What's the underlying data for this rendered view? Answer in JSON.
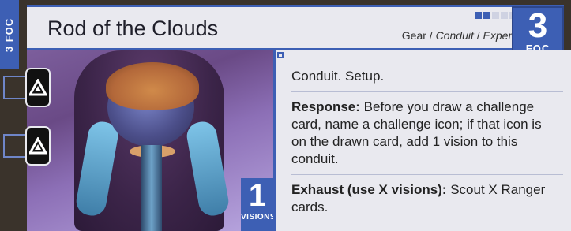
{
  "card": {
    "cost_label": "3 FOC",
    "title": "Rod of the Clouds",
    "type_gear": "Gear",
    "type_sep1": " / ",
    "type_conduit": "Conduit",
    "type_sep2": " / ",
    "type_expert": "Expert",
    "energy_number": "3",
    "energy_label": "FOC",
    "progress_filled": 2,
    "progress_total": 5,
    "vision_number": "1",
    "vision_label": "VISIONS",
    "rules": {
      "line1": "Conduit. Setup.",
      "response_keyword": "Response:",
      "response_text": " Before you draw a challenge card, name a challenge icon; if that icon is on the drawn card, add 1 vision to this conduit.",
      "exhaust_keyword": "Exhaust (use X visions):",
      "exhaust_text": " Scout X Ranger cards."
    },
    "challenge_icons": [
      "mountain-icon",
      "mountain-icon"
    ]
  },
  "colors": {
    "accent_blue": "#3d5fb4",
    "panel_bg": "#e9e9ef"
  }
}
